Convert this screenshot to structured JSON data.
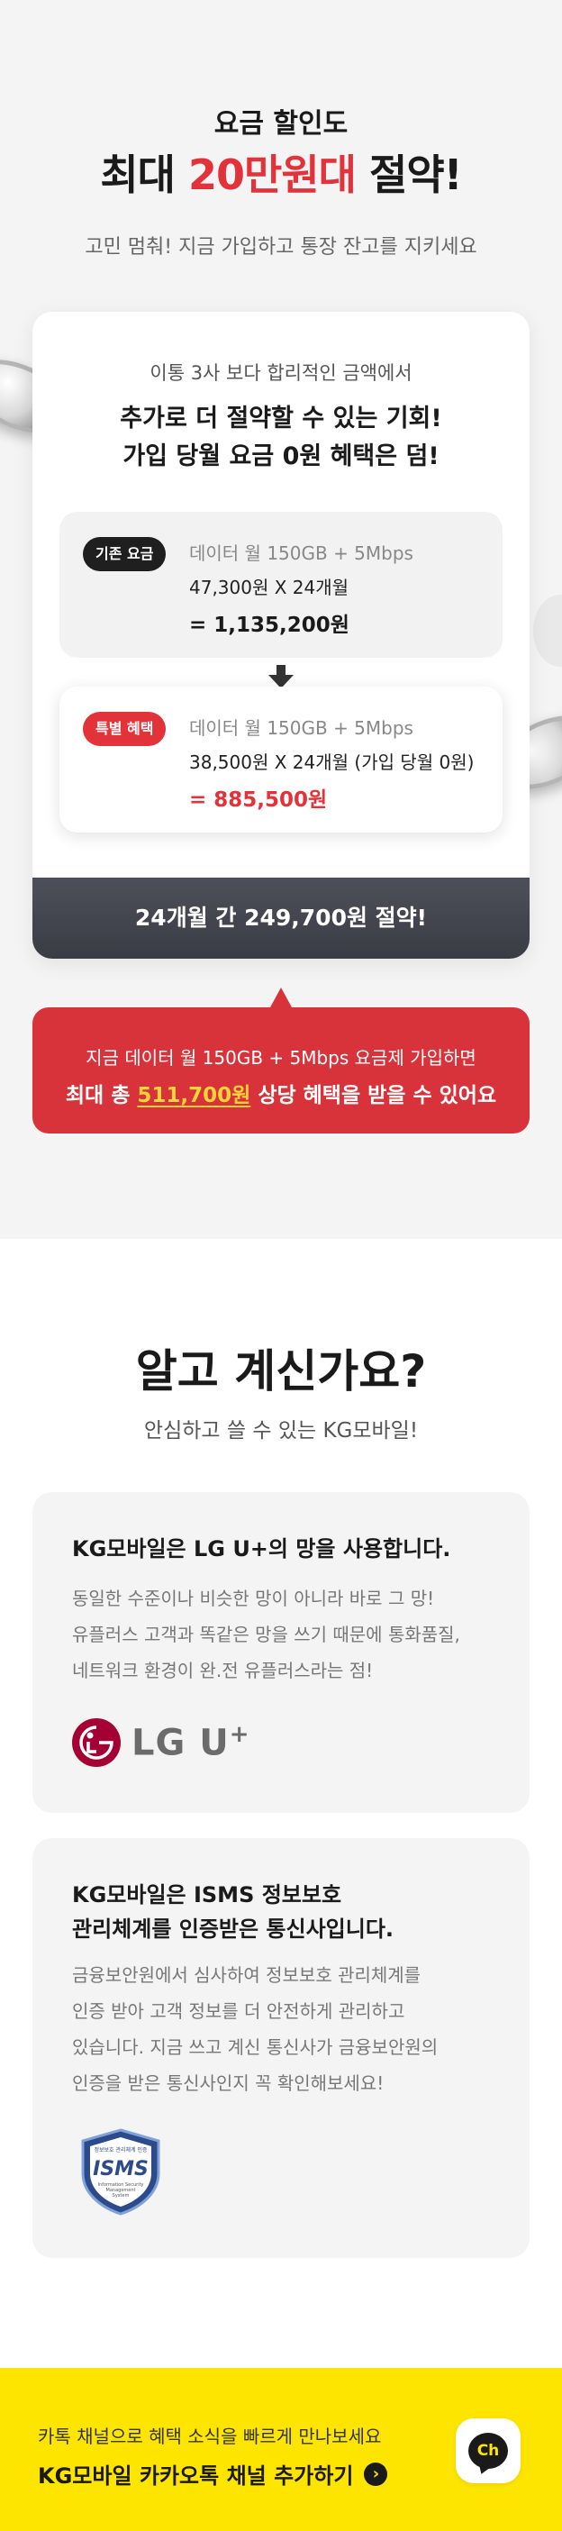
{
  "hero": {
    "subtitle": "요금 할인도",
    "title_pre": "최대 ",
    "title_highlight": "20만원대",
    "title_post": " 절약!",
    "description": "고민 멈춰! 지금 가입하고 통장 잔고를 지키세요"
  },
  "price_card": {
    "intro": "이통 3사 보다 합리적인 금액에서",
    "headline_1": "추가로 더 절약할 수 있는 기회!",
    "headline_2": "가입 당월 요금 0원 혜택은 덤!",
    "normal": {
      "badge": "기존 요금",
      "plan": "데이터 월 150GB + 5Mbps",
      "calc": "47,300원 X 24개월",
      "total": "= 1,135,200원"
    },
    "special": {
      "badge": "특별 혜택",
      "plan": "데이터 월 150GB + 5Mbps",
      "calc": "38,500원 X 24개월 (가입 당월 0원)",
      "total": "= 885,500원"
    },
    "footer": "24개월 간 249,700원 절약!"
  },
  "benefit_box": {
    "line1": "지금 데이터 월 150GB + 5Mbps 요금제 가입하면",
    "line2_pre": "최대 총 ",
    "line2_highlight": "511,700원",
    "line2_post": " 상당 혜택을 받을 수 있어요"
  },
  "about": {
    "title": "알고 계신가요?",
    "subtitle": "안심하고 쓸 수 있는 KG모바일!"
  },
  "info_lg": {
    "title": "KG모바일은 LG U+의 망을 사용합니다.",
    "text_1": "동일한 수준이나 비슷한 망이 아니라 바로 그 망!",
    "text_2": "유플러스 고객과 똑같은 망을 쓰기 때문에 통화품질,",
    "text_3": "네트워크 환경이 완.전 유플러스라는 점!",
    "logo_text": "LG U",
    "logo_sup": "+"
  },
  "info_isms": {
    "title_1": "KG모바일은 ISMS 정보보호",
    "title_2": "관리체계를 인증받은 통신사입니다.",
    "text_1": "금융보안원에서 심사하여 정보보호 관리체계를",
    "text_2": "인증 받아 고객 정보를 더 안전하게 관리하고",
    "text_3": "있습니다. 지금 쓰고 계신 통신사가 금융보안원의",
    "text_4": "인증을 받은 통신사인지 꼭 확인해보세요!",
    "badge_top": "정보보호 관리체계 인증",
    "badge_main": "ISMS",
    "badge_sub1": "Information Security",
    "badge_sub2": "Management",
    "badge_sub3": "System"
  },
  "kakao": {
    "line1": "카톡 채널으로 혜택 소식을 빠르게 만나보세요",
    "line2": "KG모바일 카카오톡 채널 추가하기",
    "button_text": "Ch"
  },
  "colors": {
    "accent_red": "#e2323a",
    "kakao_yellow": "#fee500",
    "lg_magenta": "#a50034"
  }
}
